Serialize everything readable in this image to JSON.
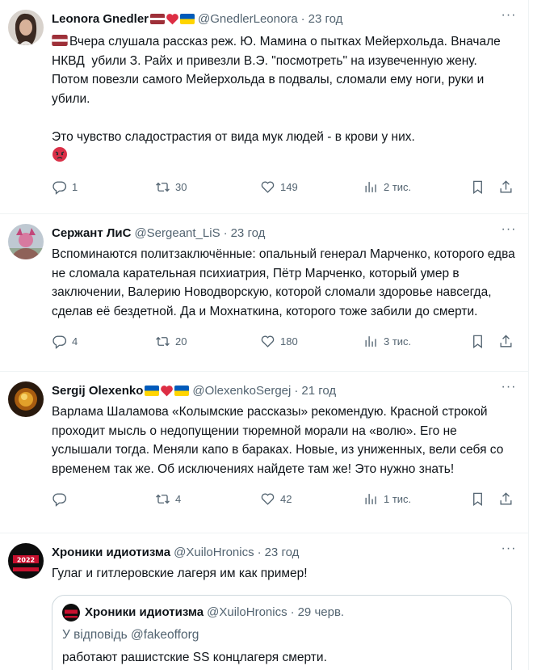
{
  "colors": {
    "text": "#0f1419",
    "secondary": "#536471",
    "border": "#eff3f4"
  },
  "tweets": [
    {
      "display_name": "Leonora Gnedler",
      "flags": [
        "latvia-flag-icon",
        "red-heart-icon",
        "ukraine-flag-icon"
      ],
      "handle": "@GnedlerLeonora",
      "time": "23 год",
      "text": "Вчера слушала рассказ реж. Ю. Мамина о пытках Мейерхольда. Вначале НКВД  убили З. Райх и привезли В.Э. \"посмотреть\" на изувеченную жену.\nПотом повезли самого Мейерхольда в подвалы, сломали ему ноги, руки и убили.\n\nЭто чувство сладострастия от вида мук людей - в крови у них.",
      "text_leading_icon": "latvia-flag-icon",
      "text_trailing_icon": "angry-face-icon",
      "replies": "1",
      "retweets": "30",
      "likes": "149",
      "views": "2 тис."
    },
    {
      "display_name": "Сержант ЛиС",
      "flags": [],
      "handle": "@Sergeant_LiS",
      "time": "23 год",
      "text": "Вспоминаются политзаключённые: опальный генерал Марченко, которого едва не сломала карательная психиатрия, Пётр Марченко, который умер в заключении, Валерию Новодворскую, которой сломали здоровье навсегда, сделав её бездетной. Да и Мохнаткина, которого тоже забили до смерти.",
      "replies": "4",
      "retweets": "20",
      "likes": "180",
      "views": "3 тис."
    },
    {
      "display_name": "Sergij Olexenko",
      "flags": [
        "ukraine-flag-icon",
        "red-heart-icon",
        "ukraine-flag-icon"
      ],
      "handle": "@OlexenkoSergej",
      "time": "21 год",
      "text": "Варлама Шаламова «Колымские рассказы» рекомендую. Красной строкой проходит мысль о недопущении тюремной морали на «волю». Его не услышали тогда. Меняли капо в бараках. Новые, из униженных, вели себя со временем так же. Об исключениях найдете там же! Это нужно знать!",
      "replies": "",
      "retweets": "4",
      "likes": "42",
      "views": "1 тис."
    },
    {
      "display_name": "Хроники идиотизма",
      "flags": [],
      "handle": "@XuiloHronics",
      "time": "23 год",
      "text": "Гулаг и гитлеровские лагеря им как пример!",
      "avatar_text": "2022",
      "quote": {
        "display_name": "Хроники идиотизма",
        "handle": "@XuiloHronics",
        "time": "29 черв.",
        "reply_prefix": "У відповідь",
        "reply_to": "@fakeofforg",
        "text": "работают рашистские SS концлагеря смерти."
      }
    }
  ]
}
